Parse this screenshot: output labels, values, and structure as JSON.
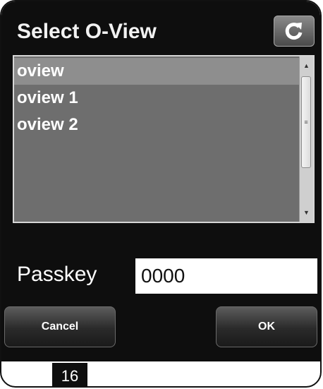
{
  "dialog": {
    "title": "Select O-View",
    "refresh_icon": "refresh-icon"
  },
  "list": {
    "items": [
      {
        "label": "oview",
        "selected": true
      },
      {
        "label": "oview 1",
        "selected": false
      },
      {
        "label": "oview 2",
        "selected": false
      }
    ]
  },
  "passkey": {
    "label": "Passkey",
    "value": "0000"
  },
  "buttons": {
    "cancel_label": "Cancel",
    "ok_label": "OK"
  },
  "page": {
    "number": "16"
  }
}
